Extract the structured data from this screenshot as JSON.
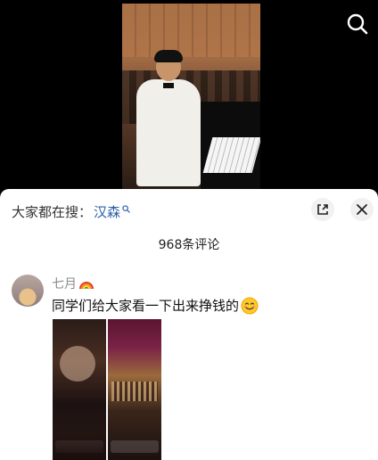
{
  "search_suggest": {
    "prefix": "大家都在搜：",
    "keyword": "汉森"
  },
  "comments_header": {
    "count_label": "968条评论"
  },
  "comment": {
    "username": "七月",
    "text": "同学们给大家看一下出来挣钱的"
  },
  "colors": {
    "keyword": "#2c5fa8",
    "username": "#8a8a8a"
  }
}
